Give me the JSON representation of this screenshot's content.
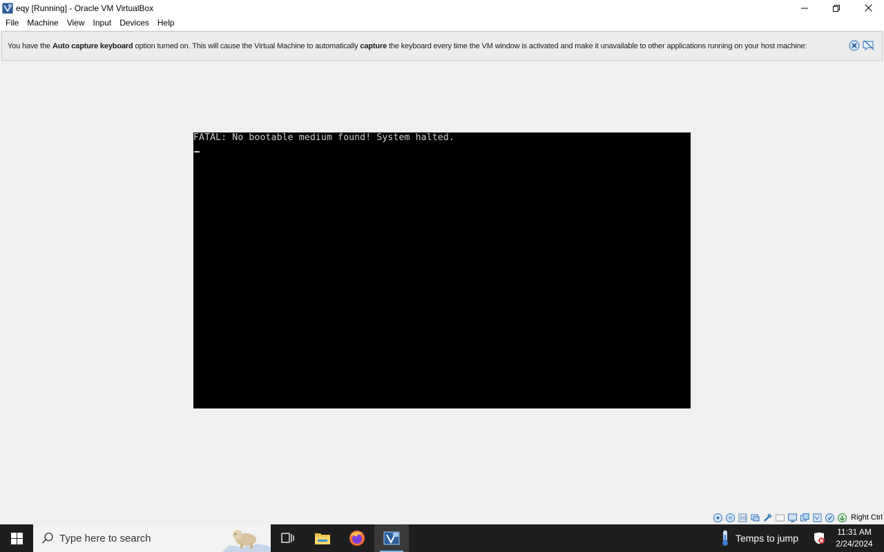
{
  "window": {
    "title": "eqy [Running] - Oracle VM VirtualBox",
    "icons": [
      "virtualbox-app-icon",
      "minimize-icon",
      "restore-icon",
      "close-icon"
    ]
  },
  "menu": {
    "items": [
      "File",
      "Machine",
      "View",
      "Input",
      "Devices",
      "Help"
    ]
  },
  "notice": {
    "part1": "You have the ",
    "bold1": "Auto capture keyboard",
    "part2": " option turned on. This will cause the Virtual Machine to automatically ",
    "bold2": "capture",
    "part3": " the keyboard every time the VM window is activated and make it unavailable to other applications running on your host machine:",
    "icons": [
      "close-notice-icon",
      "mute-notice-icon"
    ]
  },
  "vm": {
    "console_line": "FATAL: No bootable medium found! System halted.",
    "background": "#000000",
    "text_color": "#d0d0d0"
  },
  "statusbar": {
    "icons": [
      "hard-disk-icon",
      "optical-drive-icon",
      "audio-icon",
      "network-icon",
      "usb-icon",
      "shared-folders-icon",
      "display-icon",
      "recording-icon",
      "cpu-icon",
      "mouse-integration-icon",
      "keyboard-capture-icon"
    ],
    "host_key": "Right Ctrl"
  },
  "taskbar": {
    "search_placeholder": "Type here to search",
    "apps": [
      "task-view-icon",
      "file-explorer-icon",
      "firefox-icon",
      "virtualbox-icon"
    ],
    "weather": "Temps to jump",
    "time": "11:31 AM",
    "date": "2/24/2024"
  },
  "colors": {
    "window_bg": "#f0f0f0",
    "taskbar_bg": "#1e1e1e",
    "accent": "#76b9ed"
  }
}
